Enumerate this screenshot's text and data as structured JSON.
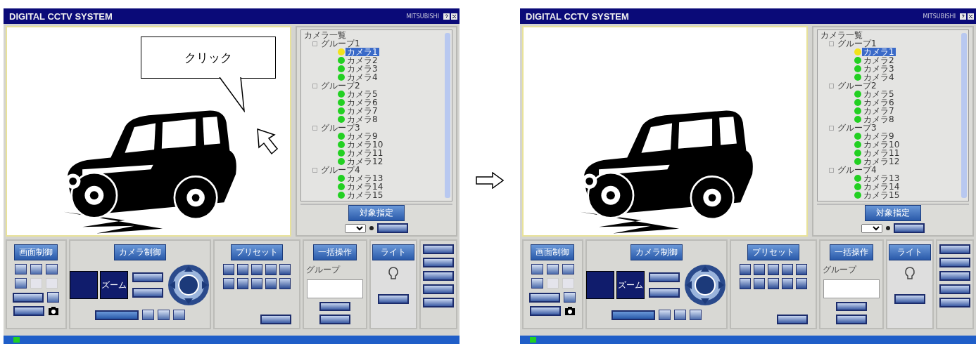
{
  "screens": [
    {
      "title": "DIGITAL CCTV SYSTEM",
      "brand": "MITSUBISHI",
      "callout": {
        "text": "クリック"
      },
      "tree": {
        "label": "カメラ一覧",
        "children": [
          {
            "label": "グループ1",
            "children": [
              {
                "label": "カメラ1",
                "selected": true,
                "color": "#f2e21c"
              },
              {
                "label": "カメラ2",
                "selected": false,
                "color": "#22d022"
              },
              {
                "label": "カメラ3",
                "selected": false,
                "color": "#22d022"
              },
              {
                "label": "カメラ4",
                "selected": false,
                "color": "#22d022"
              }
            ]
          },
          {
            "label": "グループ2",
            "children": [
              {
                "label": "カメラ5",
                "selected": false,
                "color": "#22d022"
              },
              {
                "label": "カメラ6",
                "selected": false,
                "color": "#22d022"
              },
              {
                "label": "カメラ7",
                "selected": false,
                "color": "#22d022"
              },
              {
                "label": "カメラ8",
                "selected": false,
                "color": "#22d022"
              }
            ]
          },
          {
            "label": "グループ3",
            "children": [
              {
                "label": "カメラ9",
                "selected": false,
                "color": "#22d022"
              },
              {
                "label": "カメラ10",
                "selected": false,
                "color": "#22d022"
              },
              {
                "label": "カメラ11",
                "selected": false,
                "color": "#22d022"
              },
              {
                "label": "カメラ12",
                "selected": false,
                "color": "#22d022"
              }
            ]
          },
          {
            "label": "グループ4",
            "children": [
              {
                "label": "カメラ13",
                "selected": false,
                "color": "#22d022"
              },
              {
                "label": "カメラ14",
                "selected": false,
                "color": "#22d022"
              },
              {
                "label": "カメラ15",
                "selected": false,
                "color": "#22d022"
              }
            ]
          }
        ]
      },
      "target_button": "対象指定",
      "sections": [
        {
          "kind": "screen",
          "header": "画面制御"
        },
        {
          "kind": "camera",
          "header": "カメラ制御",
          "zoom_label": "ズーム"
        },
        {
          "kind": "preset",
          "header": "プリセット"
        },
        {
          "kind": "batch",
          "header": "一括操作",
          "group_label": "グループ"
        },
        {
          "kind": "light",
          "header": "ライト"
        },
        {
          "kind": "side"
        }
      ]
    },
    {
      "title": "DIGITAL CCTV SYSTEM",
      "brand": "MITSUBISHI",
      "tree": {
        "label": "カメラ一覧",
        "children": [
          {
            "label": "グループ1",
            "children": [
              {
                "label": "カメラ1",
                "selected": true,
                "color": "#f2e21c"
              },
              {
                "label": "カメラ2",
                "selected": false,
                "color": "#22d022"
              },
              {
                "label": "カメラ3",
                "selected": false,
                "color": "#22d022"
              },
              {
                "label": "カメラ4",
                "selected": false,
                "color": "#22d022"
              }
            ]
          },
          {
            "label": "グループ2",
            "children": [
              {
                "label": "カメラ5",
                "selected": false,
                "color": "#22d022"
              },
              {
                "label": "カメラ6",
                "selected": false,
                "color": "#22d022"
              },
              {
                "label": "カメラ7",
                "selected": false,
                "color": "#22d022"
              },
              {
                "label": "カメラ8",
                "selected": false,
                "color": "#22d022"
              }
            ]
          },
          {
            "label": "グループ3",
            "children": [
              {
                "label": "カメラ9",
                "selected": false,
                "color": "#22d022"
              },
              {
                "label": "カメラ10",
                "selected": false,
                "color": "#22d022"
              },
              {
                "label": "カメラ11",
                "selected": false,
                "color": "#22d022"
              },
              {
                "label": "カメラ12",
                "selected": false,
                "color": "#22d022"
              }
            ]
          },
          {
            "label": "グループ4",
            "children": [
              {
                "label": "カメラ13",
                "selected": false,
                "color": "#22d022"
              },
              {
                "label": "カメラ14",
                "selected": false,
                "color": "#22d022"
              },
              {
                "label": "カメラ15",
                "selected": false,
                "color": "#22d022"
              }
            ]
          }
        ]
      },
      "target_button": "対象指定",
      "sections": [
        {
          "kind": "screen",
          "header": "画面制御"
        },
        {
          "kind": "camera",
          "header": "カメラ制御",
          "zoom_label": "ズーム"
        },
        {
          "kind": "preset",
          "header": "プリセット"
        },
        {
          "kind": "batch",
          "header": "一括操作",
          "group_label": "グループ"
        },
        {
          "kind": "light",
          "header": "ライト"
        },
        {
          "kind": "side"
        }
      ]
    }
  ]
}
